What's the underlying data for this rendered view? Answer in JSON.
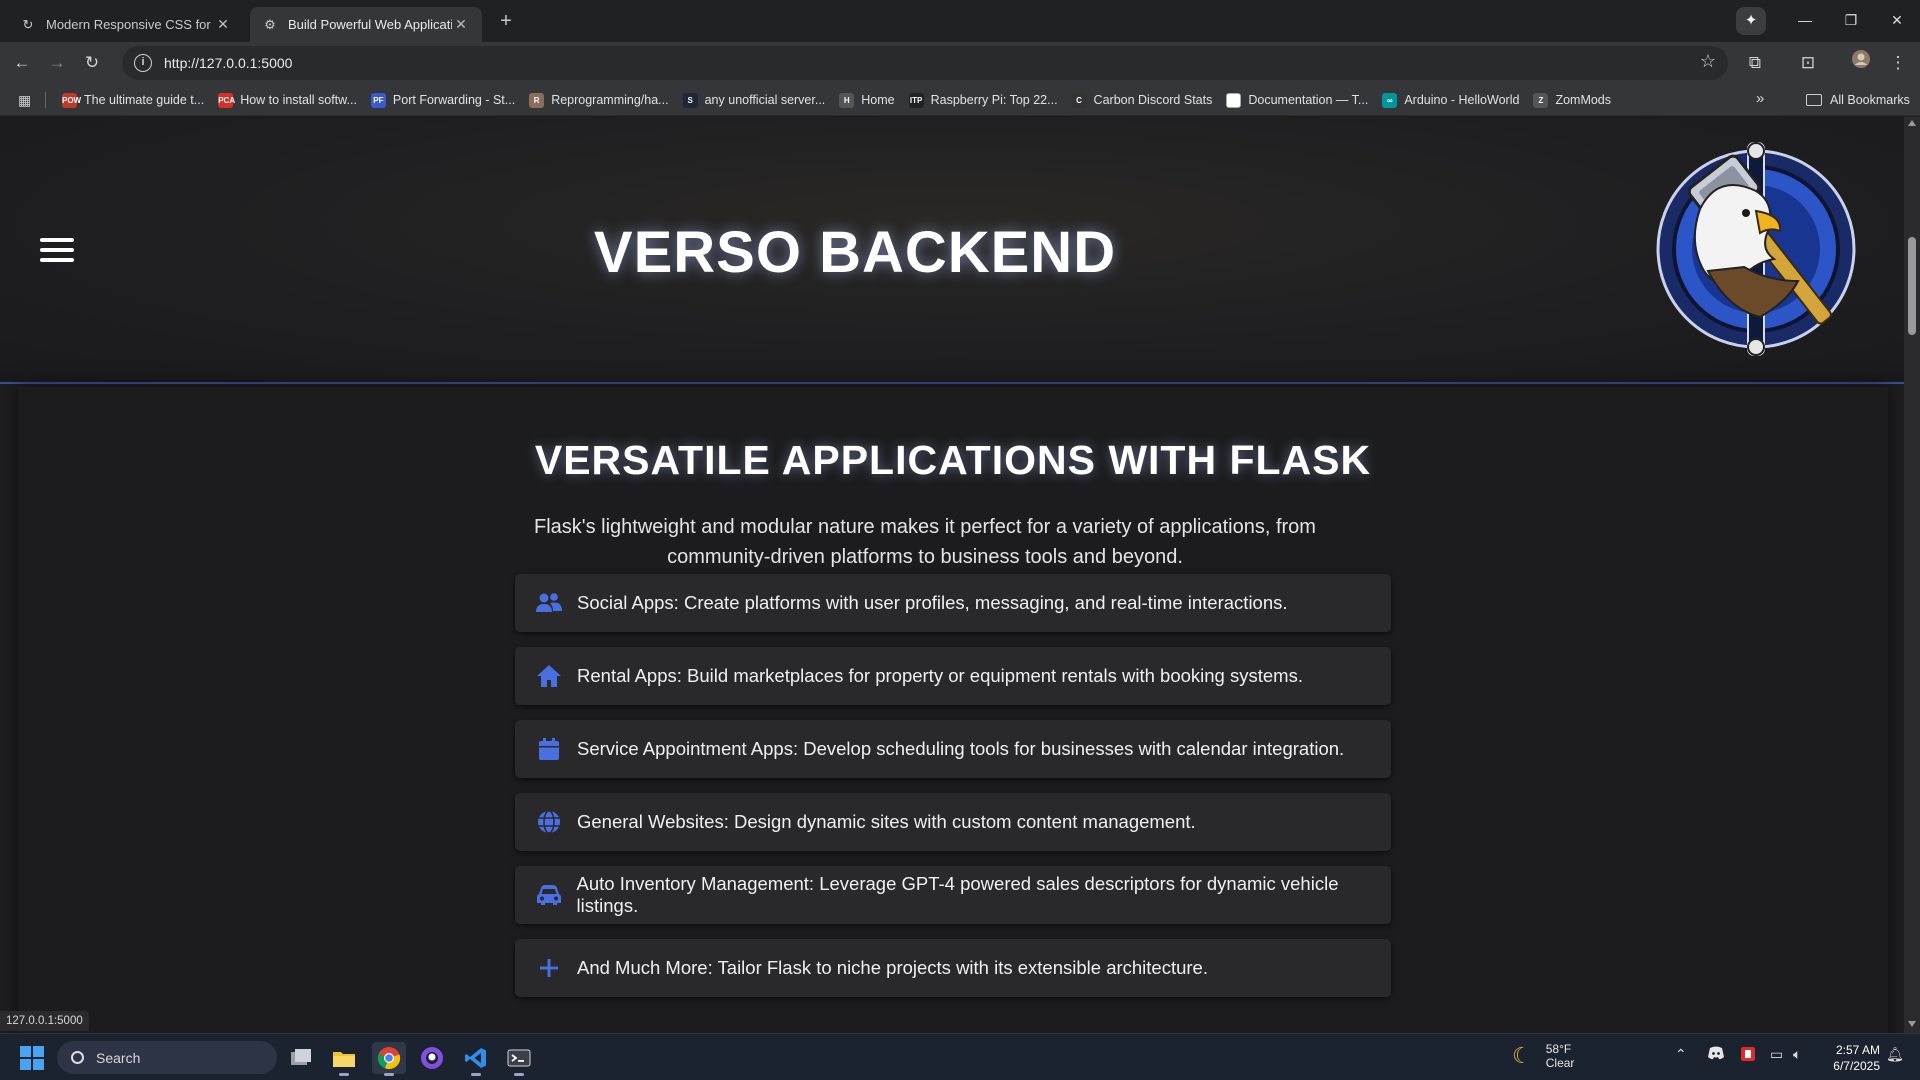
{
  "browser": {
    "tabs": [
      {
        "title": "Modern Responsive CSS for We",
        "active": false
      },
      {
        "title": "Build Powerful Web Application",
        "active": true
      }
    ],
    "new_tab": "+",
    "url": "http://127.0.0.1:5000",
    "bookmarks": [
      {
        "label": "The ultimate guide t...",
        "color": "#c0392b",
        "abbr": "POW"
      },
      {
        "label": "How to install softw...",
        "color": "#d93025",
        "abbr": "PCA"
      },
      {
        "label": "Port Forwarding - St...",
        "color": "#3a5bd0",
        "abbr": "PF"
      },
      {
        "label": "Reprogramming/ha...",
        "color": "#8a6d5a",
        "abbr": "R"
      },
      {
        "label": "any unofficial server...",
        "color": "#1b2838",
        "abbr": "S"
      },
      {
        "label": "Home",
        "color": "#555555",
        "abbr": "H"
      },
      {
        "label": "Raspberry Pi: Top 22...",
        "color": "#222222",
        "abbr": "ITP"
      },
      {
        "label": "Carbon Discord Stats",
        "color": "#333333",
        "abbr": "C"
      },
      {
        "label": "Documentation — T...",
        "color": "#ffffff",
        "abbr": ""
      },
      {
        "label": "Arduino - HelloWorld",
        "color": "#00979c",
        "abbr": "∞"
      },
      {
        "label": "ZomMods",
        "color": "#555555",
        "abbr": "Z"
      }
    ],
    "all_bookmarks": "All Bookmarks",
    "status_url": "127.0.0.1:5000"
  },
  "site": {
    "title": "VERSO BACKEND",
    "section_title": "VERSATILE APPLICATIONS WITH FLASK",
    "section_intro": "Flask's lightweight and modular nature makes it perfect for a variety of applications, from community-driven platforms to business tools and beyond.",
    "apps": [
      {
        "icon": "users-icon",
        "text": "Social Apps: Create platforms with user profiles, messaging, and real-time interactions."
      },
      {
        "icon": "home-icon",
        "text": "Rental Apps: Build marketplaces for property or equipment rentals with booking systems."
      },
      {
        "icon": "calendar-icon",
        "text": "Service Appointment Apps: Develop scheduling tools for businesses with calendar integration."
      },
      {
        "icon": "globe-icon",
        "text": "General Websites: Design dynamic sites with custom content management."
      },
      {
        "icon": "car-icon",
        "text": "Auto Inventory Management: Leverage GPT-4 powered sales descriptors for dynamic vehicle listings."
      },
      {
        "icon": "plus-icon",
        "text": "And Much More: Tailor Flask to niche projects with its extensible architecture."
      }
    ],
    "accent_color": "#4a6fe0"
  },
  "taskbar": {
    "search_placeholder": "Search",
    "weather_temp": "58°F",
    "weather_desc": "Clear",
    "time": "2:57 AM",
    "date": "6/7/2025"
  }
}
